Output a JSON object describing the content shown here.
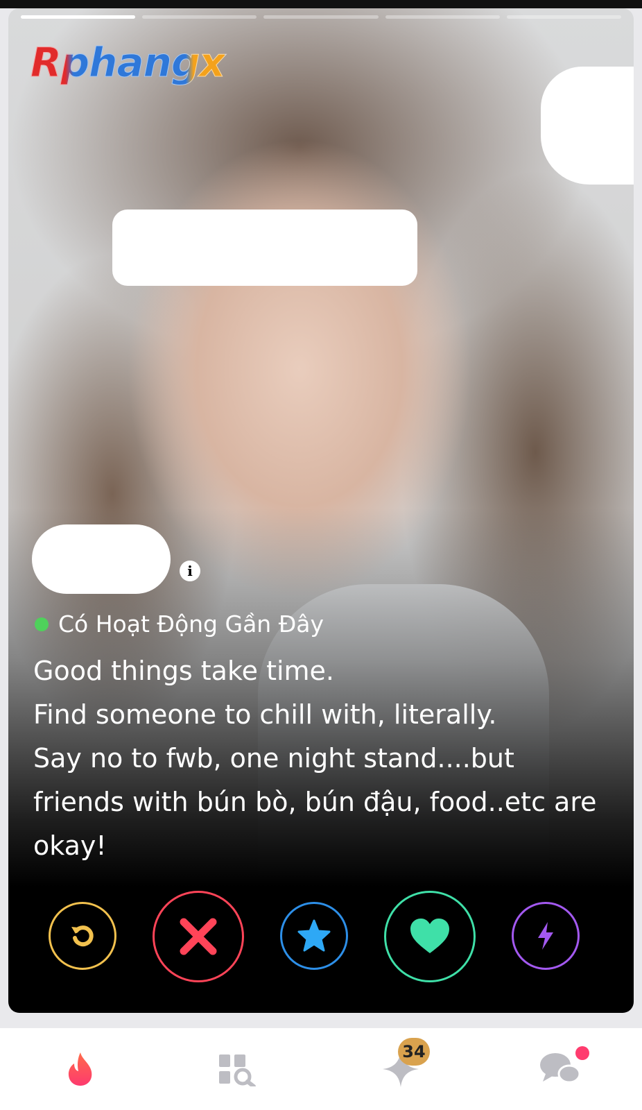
{
  "watermark": "Rphangx",
  "profile": {
    "status": "Có Hoạt Động Gần Đây",
    "bio_lines": [
      "Good things take time.",
      "Find someone to chill with, literally.",
      "Say no to fwb, one night stand....but",
      "friends with bún bò, bún đậu, food..etc are",
      "okay!"
    ],
    "photo_count": 5,
    "photo_index": 1
  },
  "actions": [
    {
      "name": "rewind",
      "icon": "rewind-icon",
      "color": "#f2c14e"
    },
    {
      "name": "nope",
      "icon": "close-icon",
      "color": "#ff4458"
    },
    {
      "name": "super-like",
      "icon": "star-icon",
      "color": "#2d8fe8"
    },
    {
      "name": "like",
      "icon": "heart-icon",
      "color": "#3fe0a8"
    },
    {
      "name": "boost",
      "icon": "lightning-icon",
      "color": "#a359f0"
    }
  ],
  "tabbar": {
    "likes_badge": "34",
    "icons": [
      "flame-icon",
      "explore-icon",
      "sparkle-icon",
      "chat-icon"
    ],
    "accent": "#fd5564"
  }
}
